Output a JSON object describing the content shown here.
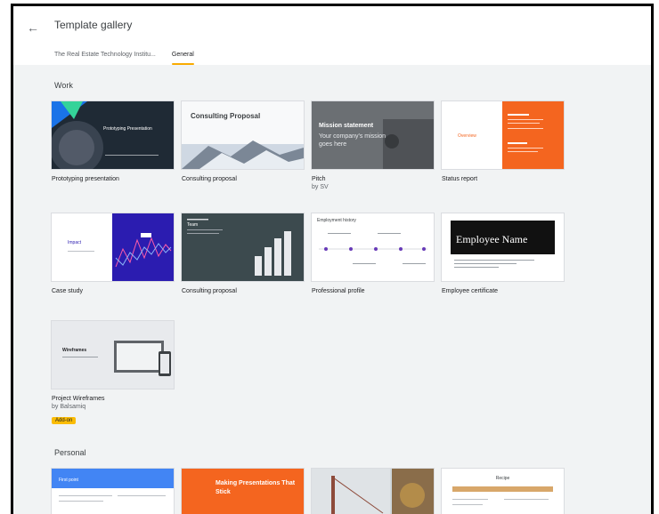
{
  "header": {
    "title": "Template gallery",
    "back_icon": "arrow-left-icon",
    "tabs": [
      {
        "label": "The Real Estate Technology Institu...",
        "active": false
      },
      {
        "label": "General",
        "active": true
      }
    ]
  },
  "sections": {
    "work": "Work",
    "personal": "Personal"
  },
  "cards": {
    "prototyping": {
      "name": "Prototyping presentation",
      "thumb_title": "Prototyping Presentation"
    },
    "consulting1": {
      "name": "Consulting proposal",
      "thumb_title": "Consulting Proposal"
    },
    "pitch": {
      "name": "Pitch",
      "by": "by SV",
      "thumb_title": "Mission statement",
      "thumb_sub": "Your company's mission goes here"
    },
    "status": {
      "name": "Status report",
      "thumb_title": "Overview"
    },
    "case": {
      "name": "Case study",
      "thumb_title": "Impact"
    },
    "consulting2": {
      "name": "Consulting proposal",
      "thumb_title": "Team"
    },
    "profile": {
      "name": "Professional profile",
      "thumb_title": "Employment history"
    },
    "certificate": {
      "name": "Employee certificate",
      "thumb_title": "Employee Name"
    },
    "wireframes": {
      "name": "Project Wireframes",
      "by": "by Balsamiq",
      "badge": "Add-on",
      "thumb_title": "Wireframes"
    },
    "personal1": {
      "thumb_title": "First point"
    },
    "personal2": {
      "thumb_title": "Making Presentations That Stick"
    },
    "personal4": {
      "thumb_title": "Recipe"
    }
  },
  "colors": {
    "accent_tab": "#f9ab00",
    "badge": "#fbbc04",
    "status_orange": "#f4651f",
    "case_blue": "#2b1cb0"
  }
}
